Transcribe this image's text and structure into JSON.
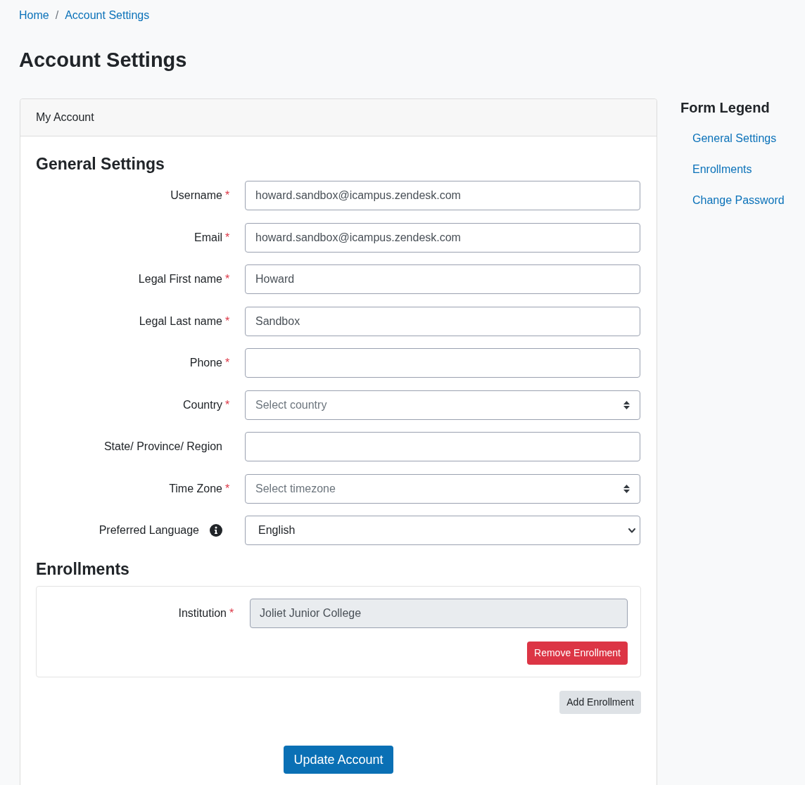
{
  "breadcrumb": {
    "separator": "/",
    "items": [
      {
        "label": "Home"
      },
      {
        "label": "Account Settings"
      }
    ]
  },
  "page_title": "Account Settings",
  "account_card": {
    "header": "My Account",
    "general_settings": {
      "heading": "General Settings",
      "fields": [
        {
          "kind": "text",
          "label": "Username",
          "required_mark": "*",
          "value": "howard.sandbox@icampus.zendesk.com"
        },
        {
          "kind": "text",
          "label": "Email",
          "required_mark": "*",
          "value": "howard.sandbox@icampus.zendesk.com"
        },
        {
          "kind": "text",
          "label": "Legal First name",
          "required_mark": "*",
          "value": "Howard"
        },
        {
          "kind": "text",
          "label": "Legal Last name",
          "required_mark": "*",
          "value": "Sandbox"
        },
        {
          "kind": "text",
          "label": "Phone",
          "required_mark": "*"
        },
        {
          "kind": "select",
          "label": "Country",
          "required_mark": "*",
          "placeholder": "Select country"
        },
        {
          "kind": "text",
          "label": "State/ Province/ Region"
        },
        {
          "kind": "select",
          "label": "Time Zone",
          "required_mark": "*",
          "placeholder": "Select timezone"
        },
        {
          "kind": "dropdown",
          "label": "Preferred Language",
          "info": true,
          "value": "English"
        }
      ]
    },
    "enrollments": {
      "heading": "Enrollments",
      "items": [
        {
          "label": "Institution",
          "required_mark": "*",
          "value": "Joliet Junior College",
          "disabled": true,
          "remove_button": "Remove Enrollment"
        }
      ],
      "add_button": "Add Enrollment"
    },
    "submit_button": "Update Account"
  },
  "form_legend": {
    "title": "Form Legend",
    "links": [
      {
        "label": "General Settings"
      },
      {
        "label": "Enrollments"
      },
      {
        "label": "Change Password"
      }
    ]
  }
}
